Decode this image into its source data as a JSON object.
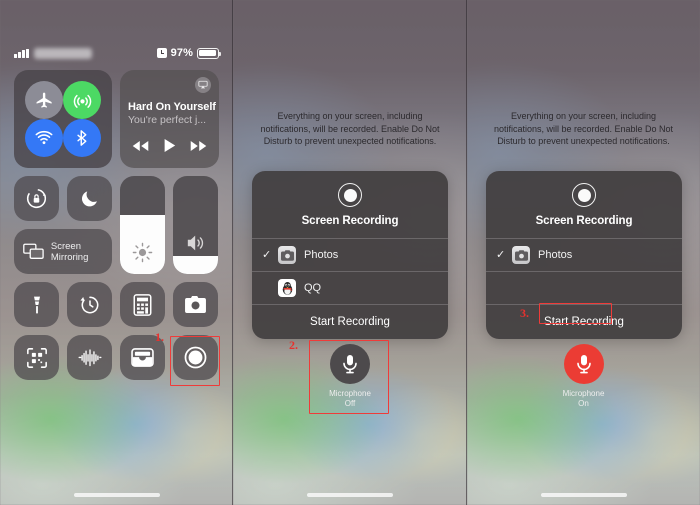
{
  "statusbar": {
    "signal_icon": "signal-bars-icon",
    "carrier": "",
    "alarm_icon": "alarm-clock-icon",
    "battery_percent": "97%",
    "battery_icon": "battery-icon"
  },
  "control_center": {
    "connectivity": {
      "airplane_label": "airplane-mode",
      "cellular_label": "cellular-data",
      "wifi_label": "wifi",
      "bluetooth_label": "bluetooth"
    },
    "music": {
      "title": "Hard On Yourself",
      "subtitle": "You're perfect j...",
      "airplay_icon": "airplay-icon",
      "prev_label": "rewind",
      "play_label": "play",
      "next_label": "fast-forward"
    },
    "rotation_lock_label": "rotation-lock",
    "do_not_disturb_label": "do-not-disturb",
    "screen_mirroring_label": "Screen Mirroring",
    "brightness": {
      "label": "brightness",
      "value": 60
    },
    "volume": {
      "label": "volume",
      "value": 18
    },
    "tools": [
      {
        "name": "flashlight",
        "icon": "flashlight-icon"
      },
      {
        "name": "timer",
        "icon": "timer-icon"
      },
      {
        "name": "calculator",
        "icon": "calculator-icon"
      },
      {
        "name": "camera",
        "icon": "camera-icon"
      },
      {
        "name": "qr-scanner",
        "icon": "qr-code-icon"
      },
      {
        "name": "voice-memos",
        "icon": "waveform-icon"
      },
      {
        "name": "wallet",
        "icon": "wallet-icon"
      },
      {
        "name": "screen-recording",
        "icon": "record-icon"
      }
    ]
  },
  "notice": "Everything on your screen, including notifications, will be recorded. Enable Do Not Disturb to prevent unexpected notifications.",
  "sheet": {
    "icon": "record-icon",
    "title": "Screen Recording",
    "rows": [
      {
        "label": "Photos",
        "icon": "photos-icon",
        "checked": true
      },
      {
        "label": "QQ",
        "icon": "qq-penguin-icon",
        "checked": false
      }
    ],
    "action": "Start Recording"
  },
  "sheet_right": {
    "icon": "record-icon",
    "title": "Screen Recording",
    "rows": [
      {
        "label": "Photos",
        "icon": "photos-icon",
        "checked": true
      },
      {
        "label": "",
        "icon": "",
        "checked": false
      }
    ],
    "action": "Start Recording"
  },
  "microphone_mid": {
    "state_line1": "Microphone",
    "state_line2": "Off",
    "icon": "microphone-icon"
  },
  "microphone_right": {
    "state_line1": "Microphone",
    "state_line2": "On",
    "icon": "microphone-icon"
  },
  "annotations": [
    {
      "number": "1.",
      "target": "screen-recording-tile"
    },
    {
      "number": "2.",
      "target": "microphone-button"
    },
    {
      "number": "3.",
      "target": "start-recording-button"
    }
  ],
  "colors": {
    "accent_red": "#ef3b39",
    "mic_on_red": "#eb3c34",
    "cellular_green": "#4cd964",
    "blue": "#3478f6"
  }
}
